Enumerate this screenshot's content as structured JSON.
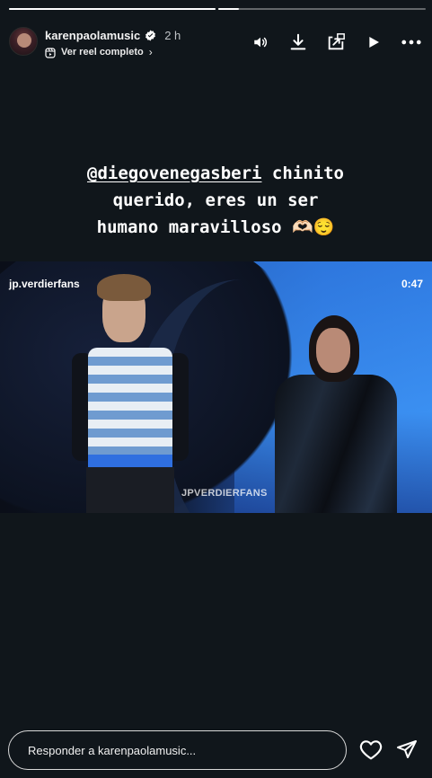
{
  "header": {
    "username": "karenpaolamusic",
    "time": "2 h",
    "reel_link": "Ver reel completo",
    "chevron": "›"
  },
  "progress": {
    "segments": 2,
    "current_segment": 2,
    "current_fraction": 0.1
  },
  "icons": {
    "volume": "volume-icon",
    "download": "download-icon",
    "share_external": "share-external-icon",
    "play": "play-icon",
    "more": "more-icon",
    "like": "heart-icon",
    "send": "send-icon",
    "verified": "verified-badge-icon"
  },
  "caption": {
    "mention": "@diegovenegasberi",
    "text_line1_rest": " chinito",
    "text_line2": "querido, eres un ser",
    "text_line3": "humano maravilloso 🫶🏻😌"
  },
  "video": {
    "account": "jp.verdierfans",
    "duration": "0:47",
    "watermark": "JPVERDIERFANS"
  },
  "reply": {
    "placeholder": "Responder a karenpaolamusic..."
  },
  "colors": {
    "background": "#10161b",
    "verified": "#ffffff",
    "video_blue": "#3a8ff0"
  }
}
